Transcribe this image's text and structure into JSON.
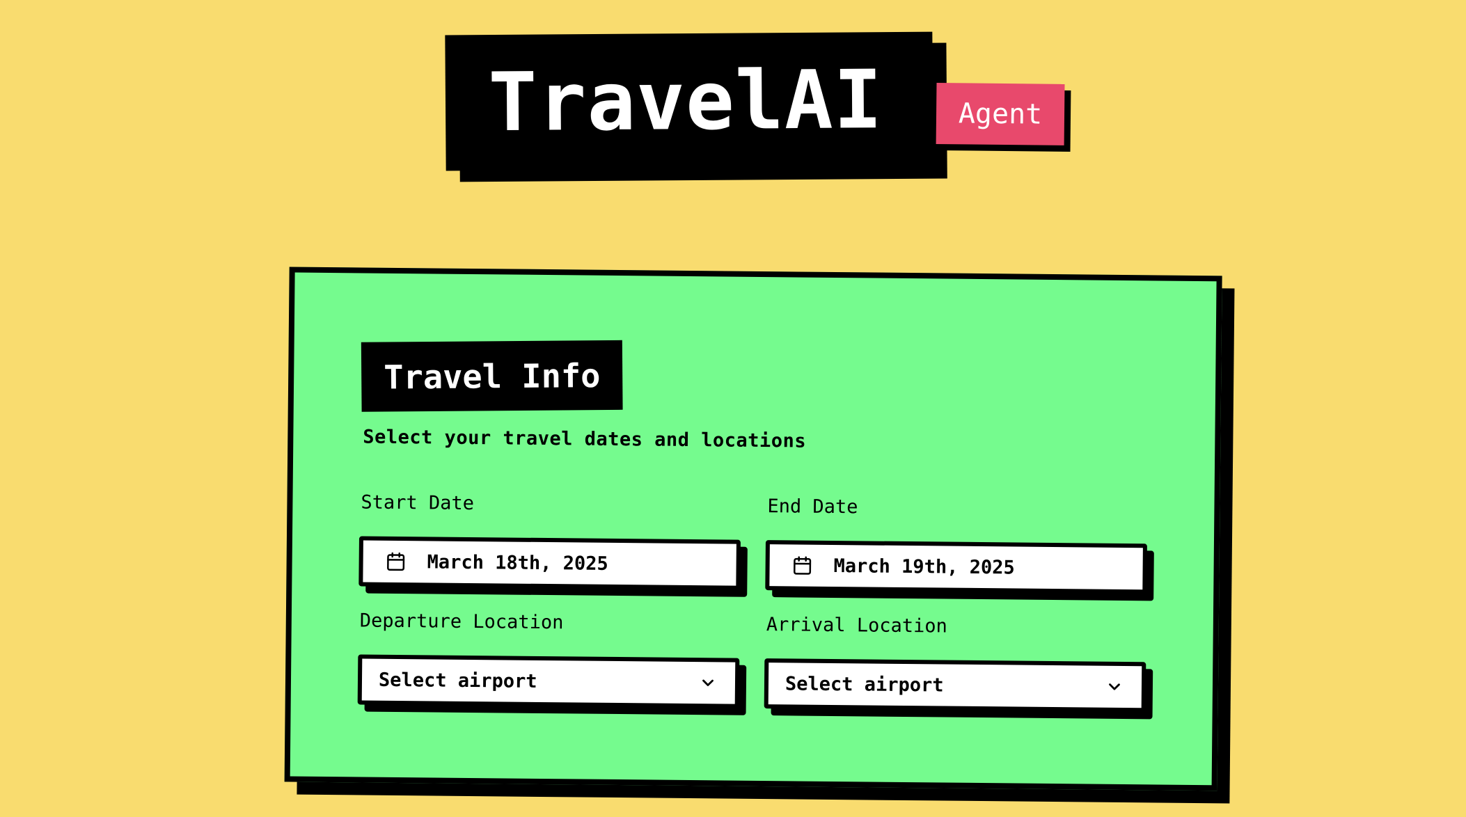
{
  "header": {
    "logo_text": "TravelAI",
    "badge_text": "Agent"
  },
  "card": {
    "title": "Travel Info",
    "subtitle": "Select your travel dates and locations",
    "start_date": {
      "label": "Start Date",
      "value": "March 18th, 2025",
      "icon": "calendar-icon"
    },
    "end_date": {
      "label": "End Date",
      "value": "March 19th, 2025",
      "icon": "calendar-icon"
    },
    "departure": {
      "label": "Departure Location",
      "placeholder": "Select airport",
      "icon": "chevron-down-icon"
    },
    "arrival": {
      "label": "Arrival Location",
      "placeholder": "Select airport",
      "icon": "chevron-down-icon"
    }
  },
  "colors": {
    "background": "#F9DC6F",
    "card": "#75FB8E",
    "badge": "#E8496C",
    "ink": "#000000"
  }
}
